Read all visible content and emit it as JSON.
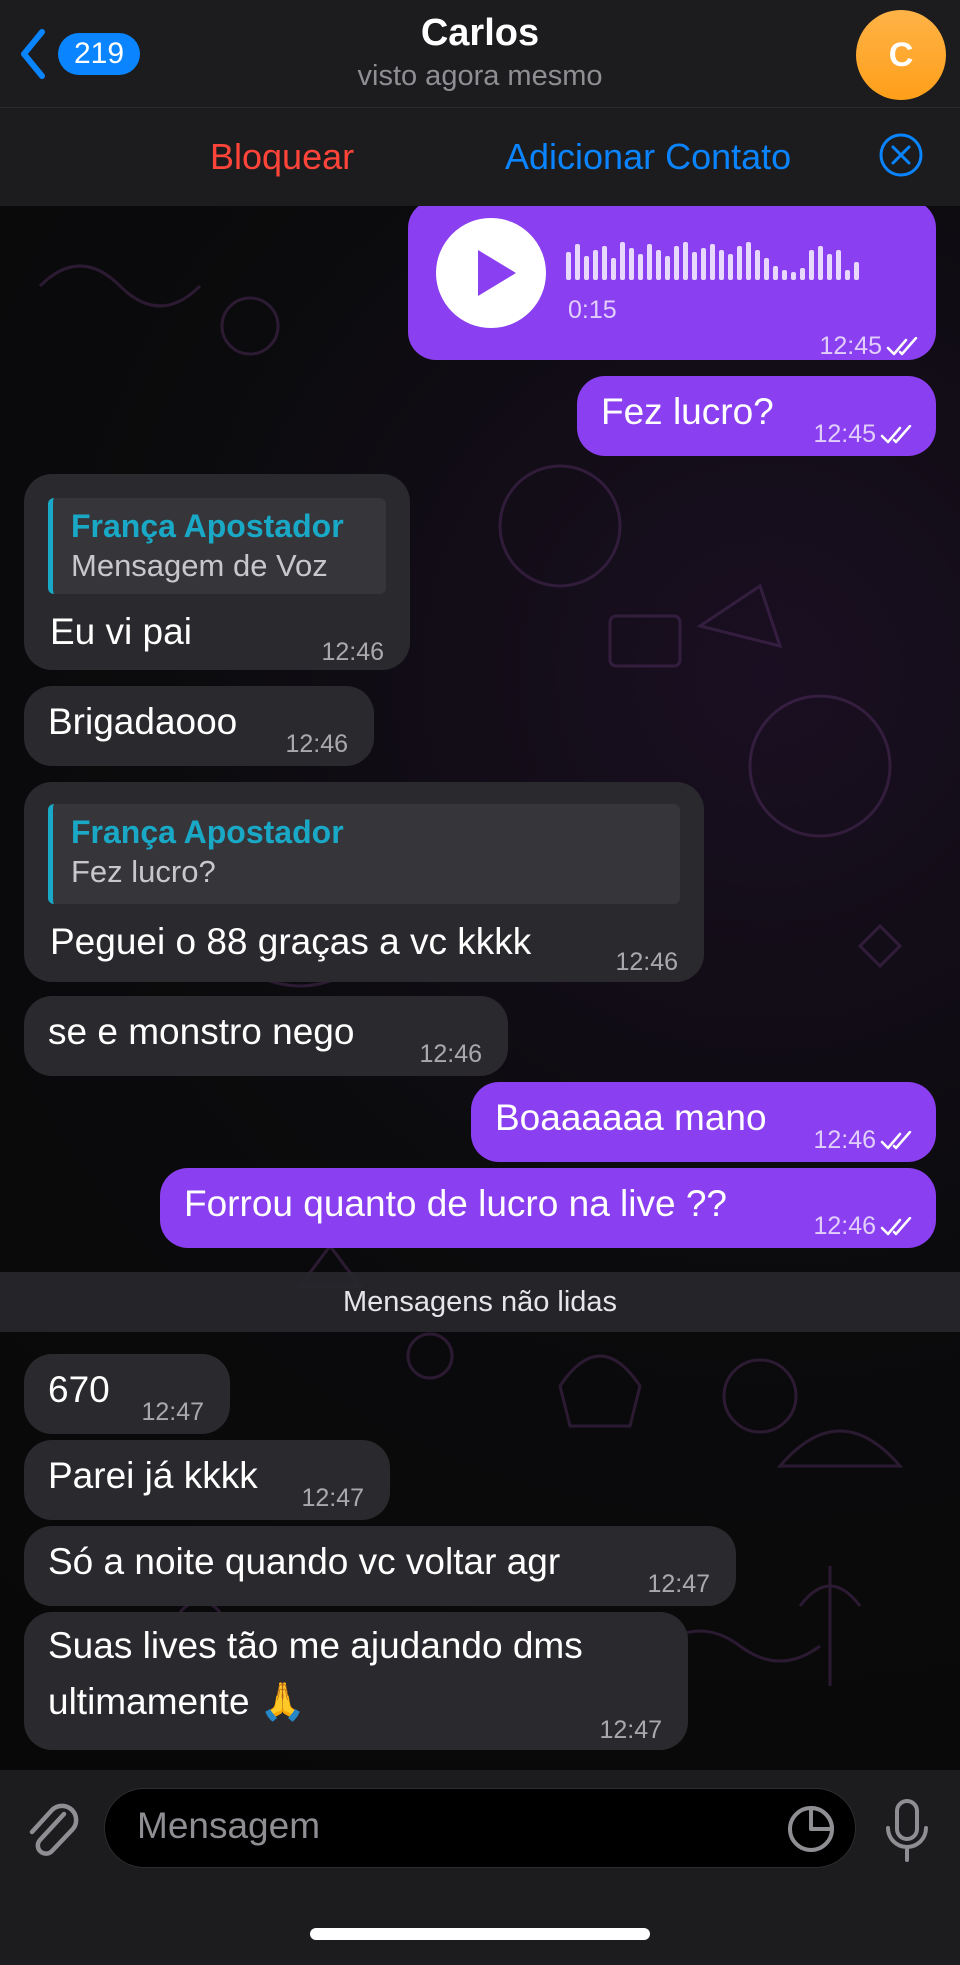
{
  "header": {
    "back_label": "",
    "unread_count": "219",
    "contact_name": "Carlos",
    "status": "visto agora mesmo",
    "avatar_initial": "C"
  },
  "actions": {
    "block": "Bloquear",
    "add_contact": "Adicionar Contato"
  },
  "voice": {
    "duration": "0:15",
    "time": "12:45"
  },
  "messages": [
    {
      "dir": "out",
      "text": "Fez lucro?",
      "time": "12:45"
    },
    {
      "dir": "in",
      "reply_name": "França Apostador",
      "reply_text": "Mensagem de Voz",
      "text": "Eu vi pai",
      "time": "12:46"
    },
    {
      "dir": "in",
      "text": "Brigadaooo",
      "time": "12:46"
    },
    {
      "dir": "in",
      "reply_name": "França Apostador",
      "reply_text": "Fez lucro?",
      "text": "Peguei o 88 graças a vc kkkk",
      "time": "12:46"
    },
    {
      "dir": "in",
      "text": "se e monstro nego",
      "time": "12:46"
    },
    {
      "dir": "out",
      "text": "Boaaaaaa mano",
      "time": "12:46"
    },
    {
      "dir": "out",
      "text": "Forrou quanto de lucro na live ??",
      "time": "12:46"
    },
    {
      "dir": "in",
      "text": "670",
      "time": "12:47"
    },
    {
      "dir": "in",
      "text": "Parei já kkkk",
      "time": "12:47"
    },
    {
      "dir": "in",
      "text": "Só a noite quando vc voltar agr",
      "time": "12:47"
    },
    {
      "dir": "in",
      "text": "Suas lives tão me ajudando dms",
      "text2": "ultimamente 🙏",
      "time": "12:47"
    }
  ],
  "divider": "Mensagens não lidas",
  "composer": {
    "placeholder": "Mensagem"
  },
  "colors": {
    "outgoing_bubble": "#8a3ff0",
    "incoming_bubble": "#2a2a2e",
    "accent": "#0a84ff",
    "danger": "#ff453a",
    "reply_accent": "#19a8c6"
  }
}
